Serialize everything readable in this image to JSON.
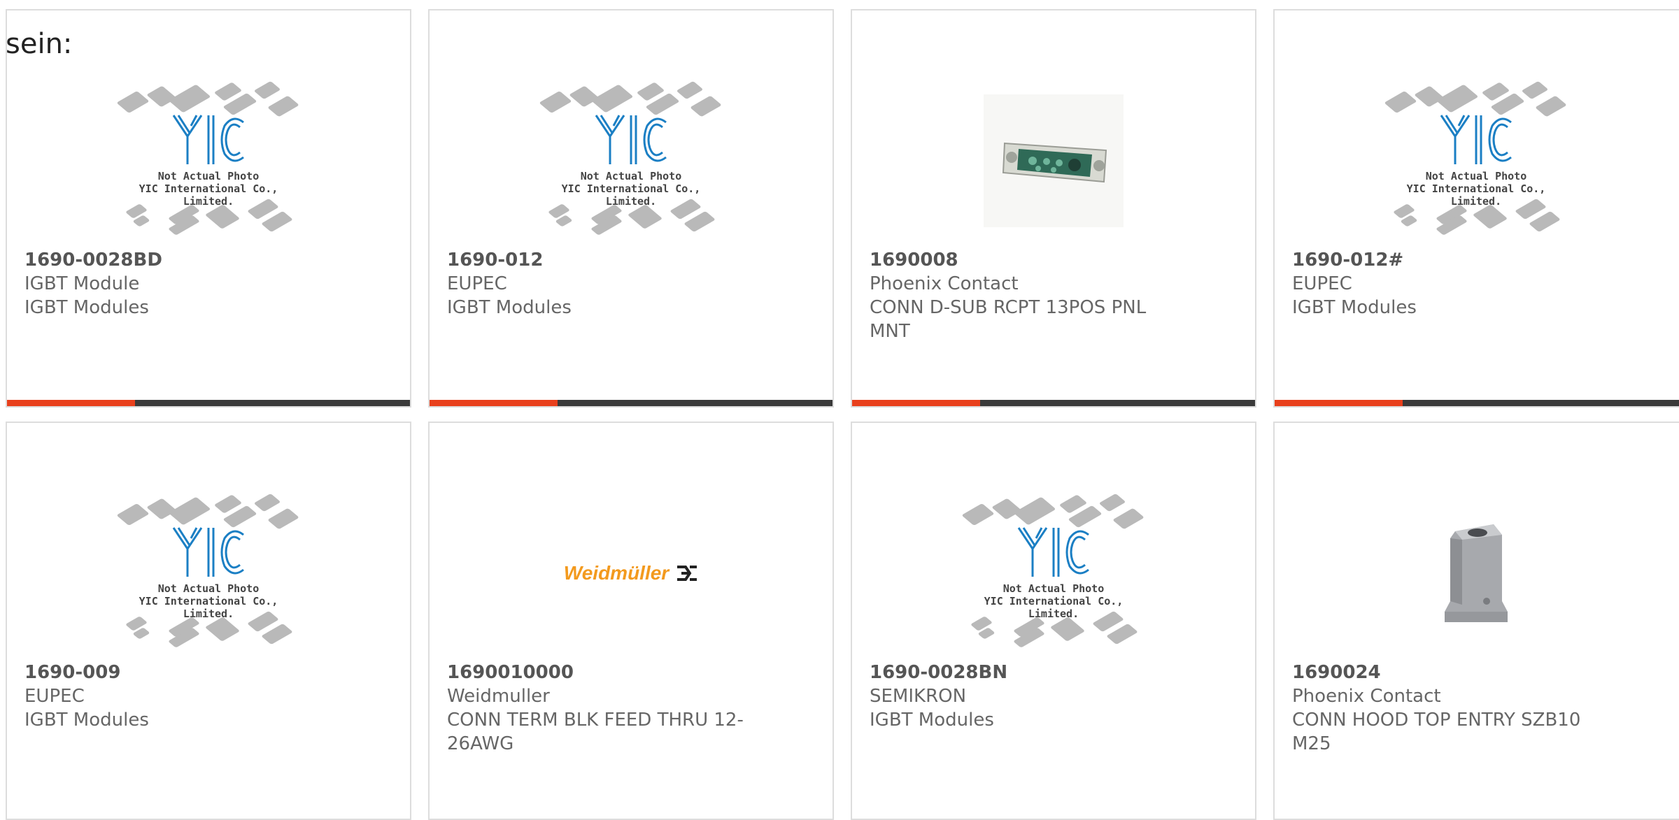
{
  "lead_text": "sein:",
  "placeholder": {
    "line1": "Not Actual Photo",
    "line2": "YIC International Co., Limited."
  },
  "colors": {
    "accent": "#e8401c",
    "bar": "#3a3a3a",
    "logo_blue": "#1b7fc4",
    "weidmuller_orange": "#f39a1e"
  },
  "cards": [
    {
      "part": "1690-0028BD",
      "maker": "IGBT Module",
      "desc": "IGBT Modules",
      "desc2": "",
      "image": "yic-placeholder",
      "has_bar": true
    },
    {
      "part": "1690-012",
      "maker": "EUPEC",
      "desc": "IGBT Modules",
      "desc2": "",
      "image": "yic-placeholder",
      "has_bar": true
    },
    {
      "part": "1690008",
      "maker": "Phoenix Contact",
      "desc": "CONN D-SUB RCPT 13POS PNL",
      "desc2": "MNT",
      "image": "dsub-connector",
      "has_bar": true
    },
    {
      "part": "1690-012#",
      "maker": "EUPEC",
      "desc": "IGBT Modules",
      "desc2": "",
      "image": "yic-placeholder",
      "has_bar": true
    },
    {
      "part": "1690-009",
      "maker": "EUPEC",
      "desc": "IGBT Modules",
      "desc2": "",
      "image": "yic-placeholder",
      "has_bar": false
    },
    {
      "part": "1690010000",
      "maker": "Weidmuller",
      "desc": "CONN TERM BLK FEED THRU 12-",
      "desc2": "26AWG",
      "image": "weidmuller-logo",
      "has_bar": false,
      "logo_text": "Weidmüller"
    },
    {
      "part": "1690-0028BN",
      "maker": "SEMIKRON",
      "desc": "IGBT Modules",
      "desc2": "",
      "image": "yic-placeholder",
      "has_bar": false
    },
    {
      "part": "1690024",
      "maker": "Phoenix Contact",
      "desc": "CONN HOOD TOP ENTRY SZB10",
      "desc2": "M25",
      "image": "hood-connector",
      "has_bar": false
    }
  ]
}
